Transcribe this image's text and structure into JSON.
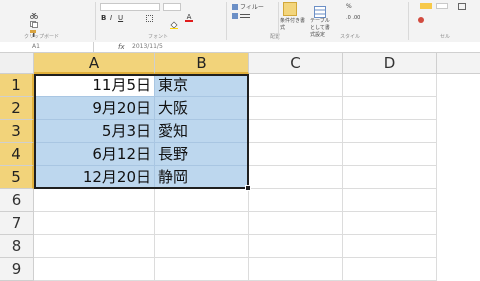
{
  "ribbon": {
    "clipboard_group": "クリップボード",
    "font_group": "フォント",
    "filter_label": "フィルー",
    "format_copy_label": "書式のコピー/貼り付け",
    "style_group": "スタイル",
    "cell_label": "セル",
    "conditional_label": "条件付き書式",
    "table_label": "テーブルとして書式設定",
    "misc_group": "配置"
  },
  "formula_bar": {
    "namebox": "A1",
    "fx": "fx",
    "value": "2013/11/5"
  },
  "columns": [
    "A",
    "B",
    "C",
    "D"
  ],
  "rows": [
    "1",
    "2",
    "3",
    "4",
    "5",
    "6",
    "7",
    "8",
    "9"
  ],
  "data": [
    {
      "a": "11月5日",
      "b": "東京"
    },
    {
      "a": "9月20日",
      "b": "大阪"
    },
    {
      "a": "5月3日",
      "b": "愛知"
    },
    {
      "a": "6月12日",
      "b": "長野"
    },
    {
      "a": "12月20日",
      "b": "静岡"
    }
  ],
  "colors": {
    "selection_fill": "#bdd7ee",
    "header_highlight": "#f2d37a"
  }
}
